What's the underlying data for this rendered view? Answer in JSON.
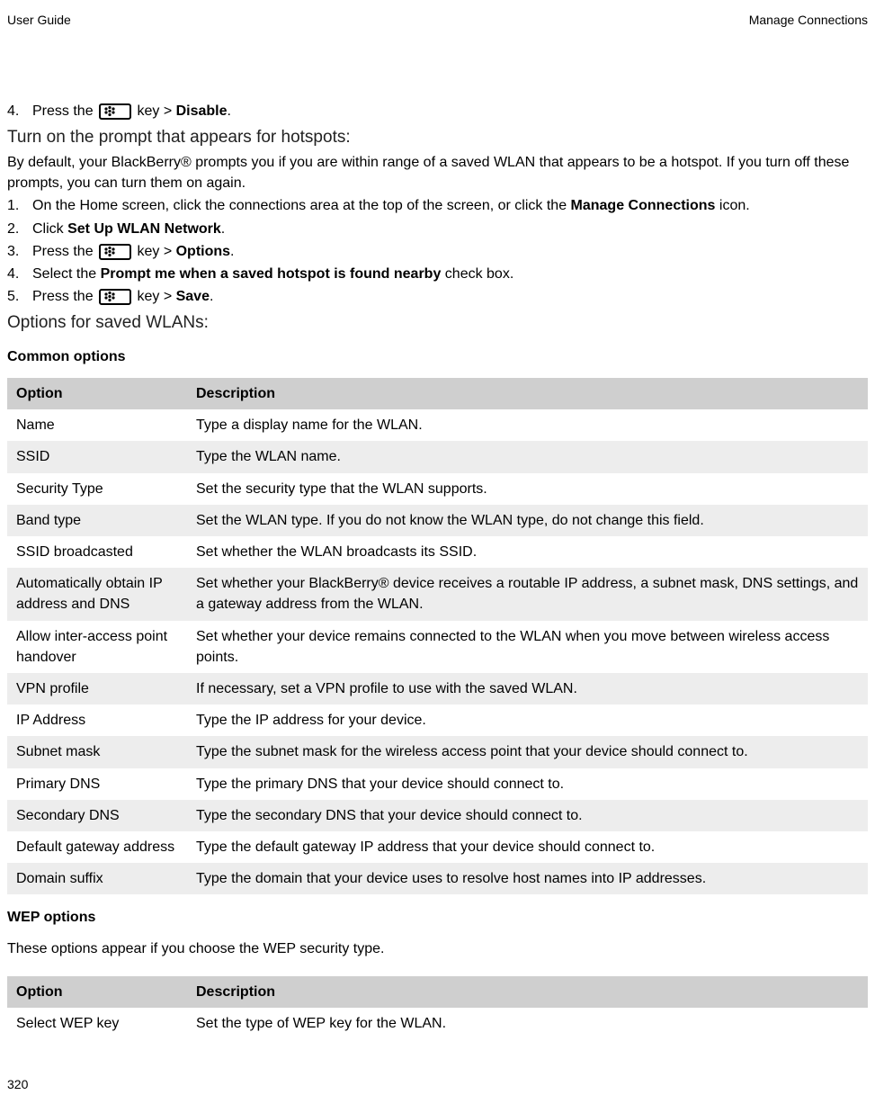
{
  "header": {
    "left": "User Guide",
    "right": "Manage Connections"
  },
  "icon_label": "blackberry-menu-key-icon",
  "step4": {
    "num": "4.",
    "prefix": "Press the ",
    "mid": " key > ",
    "bold": "Disable",
    "suffix": "."
  },
  "heading1": "Turn on the prompt that appears for hotspots:",
  "intro1": "By default, your BlackBerry® prompts you if you are within range of a saved WLAN that appears to be a hotspot. If you turn off these prompts, you can turn them on again.",
  "steps1": [
    {
      "num": "1.",
      "text_pre": "On the Home screen, click the connections area at the top of the screen, or click the ",
      "bold": "Manage Connections",
      "text_post": " icon."
    },
    {
      "num": "2.",
      "text_pre": "Click ",
      "bold": "Set Up WLAN Network",
      "text_post": "."
    },
    {
      "num": "3.",
      "icon": true,
      "prefix": "Press the ",
      "mid": " key > ",
      "bold": "Options",
      "suffix": "."
    },
    {
      "num": "4.",
      "text_pre": "Select the ",
      "bold": "Prompt me when a saved hotspot is found nearby",
      "text_post": " check box."
    },
    {
      "num": "5.",
      "icon": true,
      "prefix": "Press the ",
      "mid": " key > ",
      "bold": "Save",
      "suffix": "."
    }
  ],
  "heading2": "Options for saved WLANs:",
  "sub2": "Common options",
  "table_headers": {
    "col1": "Option",
    "col2": "Description"
  },
  "common_options": [
    {
      "opt": "Name",
      "desc": "Type a display name for the WLAN."
    },
    {
      "opt": "SSID",
      "desc": "Type the WLAN name."
    },
    {
      "opt": "Security Type",
      "desc": "Set the security type that the WLAN supports."
    },
    {
      "opt": "Band type",
      "desc": "Set the WLAN type. If you do not know the WLAN type, do not change this field."
    },
    {
      "opt": "SSID broadcasted",
      "desc": "Set whether the WLAN broadcasts its SSID."
    },
    {
      "opt": "Automatically obtain IP address and DNS",
      "desc": "Set whether your BlackBerry® device receives a routable IP address, a subnet mask, DNS settings, and a gateway address from the WLAN."
    },
    {
      "opt": "Allow inter-access point handover",
      "desc": "Set whether your device remains connected to the WLAN when you move between wireless access points."
    },
    {
      "opt": "VPN profile",
      "desc": "If necessary, set a VPN profile to use with the saved WLAN."
    },
    {
      "opt": "IP Address",
      "desc": "Type the IP address for your device."
    },
    {
      "opt": "Subnet mask",
      "desc": "Type the subnet mask for the wireless access point that your device should connect to."
    },
    {
      "opt": "Primary DNS",
      "desc": "Type the primary DNS that your device should connect to."
    },
    {
      "opt": "Secondary DNS",
      "desc": "Type the secondary DNS that your device should connect to."
    },
    {
      "opt": "Default gateway address",
      "desc": "Type the default gateway IP address that your device should connect to."
    },
    {
      "opt": "Domain suffix",
      "desc": "Type the domain that your device uses to resolve host names into IP addresses."
    }
  ],
  "sub3": "WEP options",
  "wep_intro": "These options appear if you choose the WEP security type.",
  "wep_options": [
    {
      "opt": "Select WEP key",
      "desc": "Set the type of WEP key for the WLAN."
    }
  ],
  "page_number": "320"
}
